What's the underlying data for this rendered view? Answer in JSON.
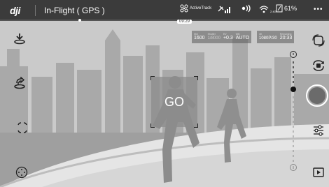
{
  "app": {
    "logo": "dji",
    "flight_mode": "In-Flight ( GPS )",
    "flight_time": "09:29"
  },
  "status": {
    "active_track_label": "ActiveTrack",
    "wifi_sub": "2.4G",
    "battery_percent": "61%"
  },
  "camera_settings": {
    "iso_label": "ISO",
    "iso_value": "1600",
    "shutter_label": "Shutter",
    "shutter_value": "1/8000",
    "ev_label": "EV",
    "ev_value": "+0.3",
    "wb_label": "WB",
    "wb_value": "AUTO",
    "resolution_label": "4K",
    "resolution_value": "1080P/30",
    "remaining_label": "Remaining",
    "remaining_value": "20:33"
  },
  "tracking": {
    "go_label": "GO"
  },
  "colors": {
    "topbar": "#3b3b3b",
    "sky": "#c9c9c9",
    "road": "#e8e8e8",
    "grass": "#a3a3a3",
    "accent": "#ffffff"
  }
}
